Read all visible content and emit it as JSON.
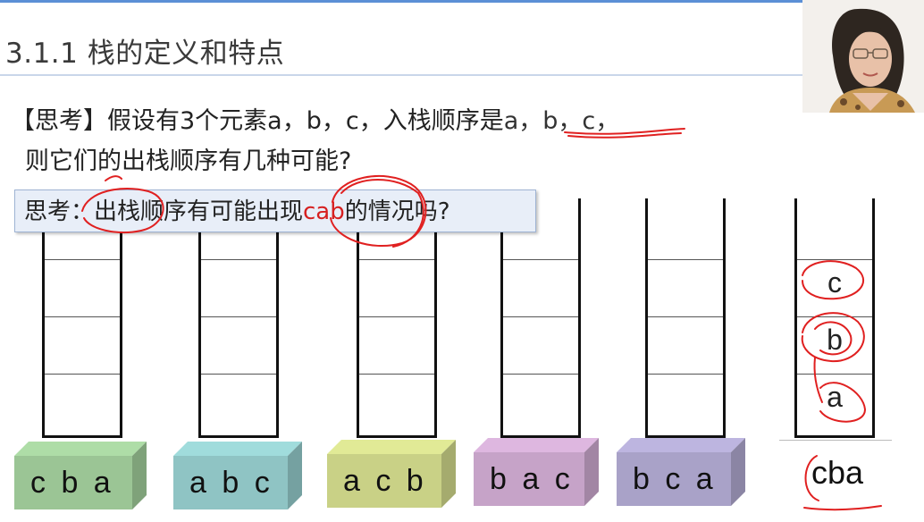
{
  "title": "3.1.1 栈的定义和特点",
  "question": {
    "line1_prefix": "【思考】假设有3个元素a，b，c，入栈顺序是",
    "line1_highlight": "a，b，c，",
    "line2": "则它们的出栈顺序有几种可能?"
  },
  "callout": {
    "prefix": "思考：出栈顺序有可能出现",
    "highlight": "cab",
    "suffix": "的情况吗?"
  },
  "stacks": [
    {
      "cells": [
        "",
        "",
        "",
        ""
      ]
    },
    {
      "cells": [
        "",
        "",
        "",
        ""
      ]
    },
    {
      "cells": [
        "",
        "",
        "",
        ""
      ]
    },
    {
      "cells": [
        "",
        "",
        "",
        ""
      ]
    },
    {
      "cells": [
        "",
        "",
        "",
        ""
      ]
    },
    {
      "cells": [
        "c",
        "b",
        "a"
      ]
    }
  ],
  "sequences": [
    {
      "label": "c b a",
      "color": "#9bc595"
    },
    {
      "label": "a b c",
      "color": "#8fc4c4"
    },
    {
      "label": "a c b",
      "color": "#c9d186"
    },
    {
      "label": "b a c",
      "color": "#c6a3c8"
    },
    {
      "label": "b c a",
      "color": "#a9a2c8"
    }
  ],
  "result": "cba",
  "colors": {
    "accent": "#5b8fd6",
    "annotation": "#e02020"
  }
}
